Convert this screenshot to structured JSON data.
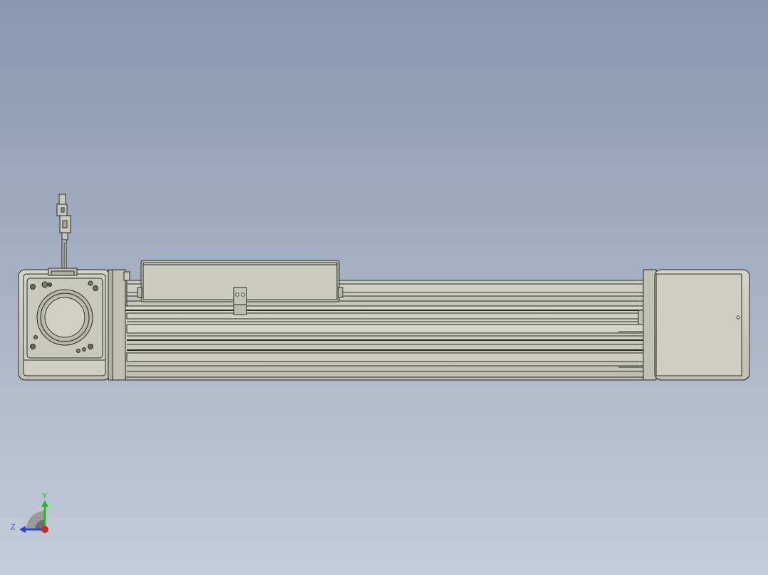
{
  "triad": {
    "y_label": "Y",
    "z_label": "Z",
    "y_color": "#22bb22",
    "z_color": "#2244dd",
    "x_color": "#dd2222"
  },
  "colors": {
    "part_fill": "#c8c8bc",
    "part_fill_light": "#d4d4c8",
    "part_fill_dark": "#b4b4a8",
    "edge": "#2a2a2a"
  }
}
